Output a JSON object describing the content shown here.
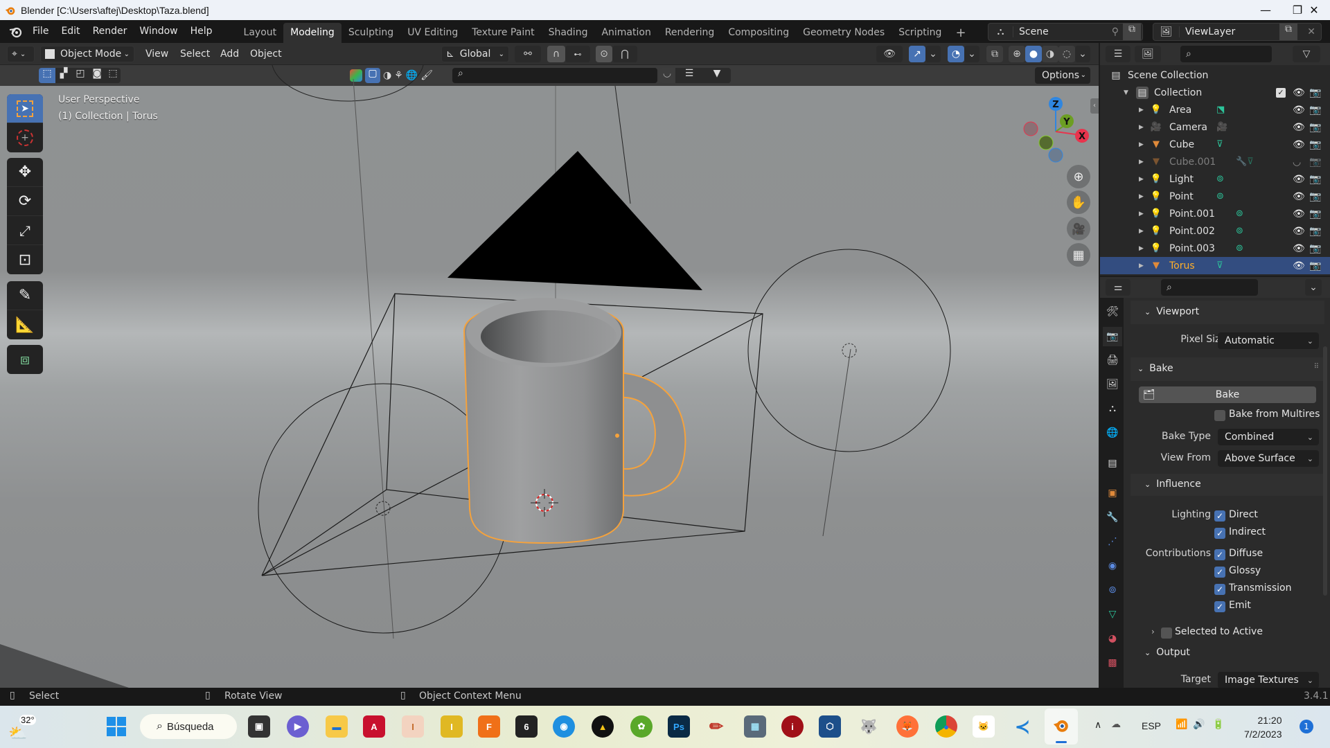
{
  "window": {
    "title": "Blender [C:\\Users\\aftej\\Desktop\\Taza.blend]",
    "controls": {
      "minimize": "—",
      "maximize": "❐",
      "close": "✕"
    }
  },
  "menubar": {
    "items": [
      "File",
      "Edit",
      "Render",
      "Window",
      "Help"
    ],
    "workspaces": [
      "Layout",
      "Modeling",
      "Sculpting",
      "UV Editing",
      "Texture Paint",
      "Shading",
      "Animation",
      "Rendering",
      "Compositing",
      "Geometry Nodes",
      "Scripting"
    ],
    "active_workspace": "Modeling",
    "add_workspace": "+",
    "scene": "Scene",
    "view_layer": "ViewLayer"
  },
  "header": {
    "mode": "Object Mode",
    "menus": [
      "View",
      "Select",
      "Add",
      "Object"
    ],
    "transform_orientation": "Global",
    "options_label": "Options"
  },
  "viewport": {
    "view_name": "User Perspective",
    "view_context": "(1) Collection | Torus",
    "gizmo_axes": [
      "Z",
      "Y",
      "X"
    ],
    "axis_colors": {
      "x": "#e8344d",
      "y": "#6c9e23",
      "z": "#2f86e0"
    },
    "selection_color": "#f5a23c",
    "active_tool": "select-box",
    "tools": [
      "select-box",
      "cursor",
      "move",
      "rotate",
      "scale",
      "transform",
      "annotate",
      "measure",
      "add-cube"
    ],
    "nav_buttons": [
      "zoom",
      "pan",
      "camera",
      "ortho-grid"
    ]
  },
  "outliner": {
    "root": "Scene Collection",
    "collection": "Collection",
    "items": [
      {
        "name": "Area",
        "type": "light",
        "data_icon": "area-light",
        "visible": true
      },
      {
        "name": "Camera",
        "type": "camera",
        "data_icon": "camera-data",
        "visible": true
      },
      {
        "name": "Cube",
        "type": "mesh",
        "data_icon": "mesh-data",
        "visible": true
      },
      {
        "name": "Cube.001",
        "type": "mesh",
        "data_icon": "modifier-mesh",
        "visible": false
      },
      {
        "name": "Light",
        "type": "light",
        "data_icon": "point-light",
        "visible": true
      },
      {
        "name": "Point",
        "type": "light",
        "data_icon": "point-light",
        "visible": true
      },
      {
        "name": "Point.001",
        "type": "light",
        "data_icon": "point-light",
        "visible": true
      },
      {
        "name": "Point.002",
        "type": "light",
        "data_icon": "point-light",
        "visible": true
      },
      {
        "name": "Point.003",
        "type": "light",
        "data_icon": "point-light",
        "visible": true
      },
      {
        "name": "Torus",
        "type": "mesh",
        "data_icon": "mesh-data",
        "visible": true,
        "selected": true
      }
    ]
  },
  "properties": {
    "viewport_section": "Viewport",
    "pixel_size_label": "Pixel Size",
    "pixel_size_value": "Automatic",
    "bake_section": "Bake",
    "bake_button": "Bake",
    "bake_from_multires": {
      "label": "Bake from Multires",
      "checked": false
    },
    "bake_type_label": "Bake Type",
    "bake_type_value": "Combined",
    "view_from_label": "View From",
    "view_from_value": "Above Surface",
    "influence_section": "Influence",
    "lighting_label": "Lighting",
    "lighting": [
      {
        "label": "Direct",
        "checked": true
      },
      {
        "label": "Indirect",
        "checked": true
      }
    ],
    "contributions_label": "Contributions",
    "contributions": [
      {
        "label": "Diffuse",
        "checked": true
      },
      {
        "label": "Glossy",
        "checked": true
      },
      {
        "label": "Transmission",
        "checked": true
      },
      {
        "label": "Emit",
        "checked": true
      }
    ],
    "selected_to_active": {
      "label": "Selected to Active",
      "checked": false
    },
    "output_section": "Output",
    "target_label": "Target",
    "target_value": "Image Textures"
  },
  "statusbar": {
    "hints": [
      "Select",
      "Rotate View",
      "Object Context Menu"
    ],
    "version": "3.4.1"
  },
  "taskbar": {
    "weather": "32°",
    "search_label": "Búsqueda",
    "apps": [
      "Task View",
      "Teams",
      "File Explorer",
      "AutoCAD",
      "Inventor",
      "Inventor Pro",
      "Fusion 360",
      "Rhino 6",
      "Cinema",
      "Avast",
      "SketchUp",
      "Photoshop",
      "Pencil",
      "Calculator",
      "Adobe",
      "VirtualBox",
      "GIMP",
      "Firefox",
      "Chrome",
      "Inkscape",
      "VS Code",
      "Blender"
    ],
    "language": "ESP",
    "time": "21:20",
    "date": "7/2/2023",
    "notifications": "1"
  }
}
